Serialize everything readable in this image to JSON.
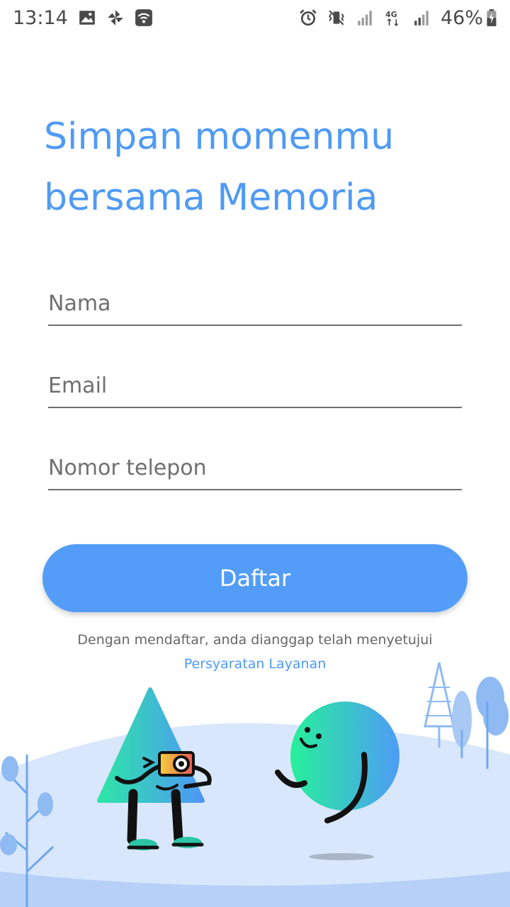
{
  "status_bar": {
    "time": "13:14",
    "battery": "46%",
    "icons_left": [
      "image-icon",
      "pinwheel-icon",
      "wifi-icon"
    ],
    "icons_right": [
      "alarm-icon",
      "vibrate-icon",
      "signal-icon",
      "4g-icon",
      "signal-icon",
      "battery-icon"
    ]
  },
  "headline": {
    "line1": "Simpan momenmu",
    "line2": "bersama Memoria"
  },
  "form": {
    "name_placeholder": "Nama",
    "email_placeholder": "Email",
    "phone_placeholder": "Nomor telepon",
    "submit_label": "Daftar"
  },
  "terms": {
    "text": "Dengan mendaftar, anda dianggap telah menyetujui",
    "link": "Persyaratan Layanan"
  },
  "colors": {
    "accent": "#539df9",
    "heading": "#4f9af5",
    "ground": "#d6e6fb"
  }
}
